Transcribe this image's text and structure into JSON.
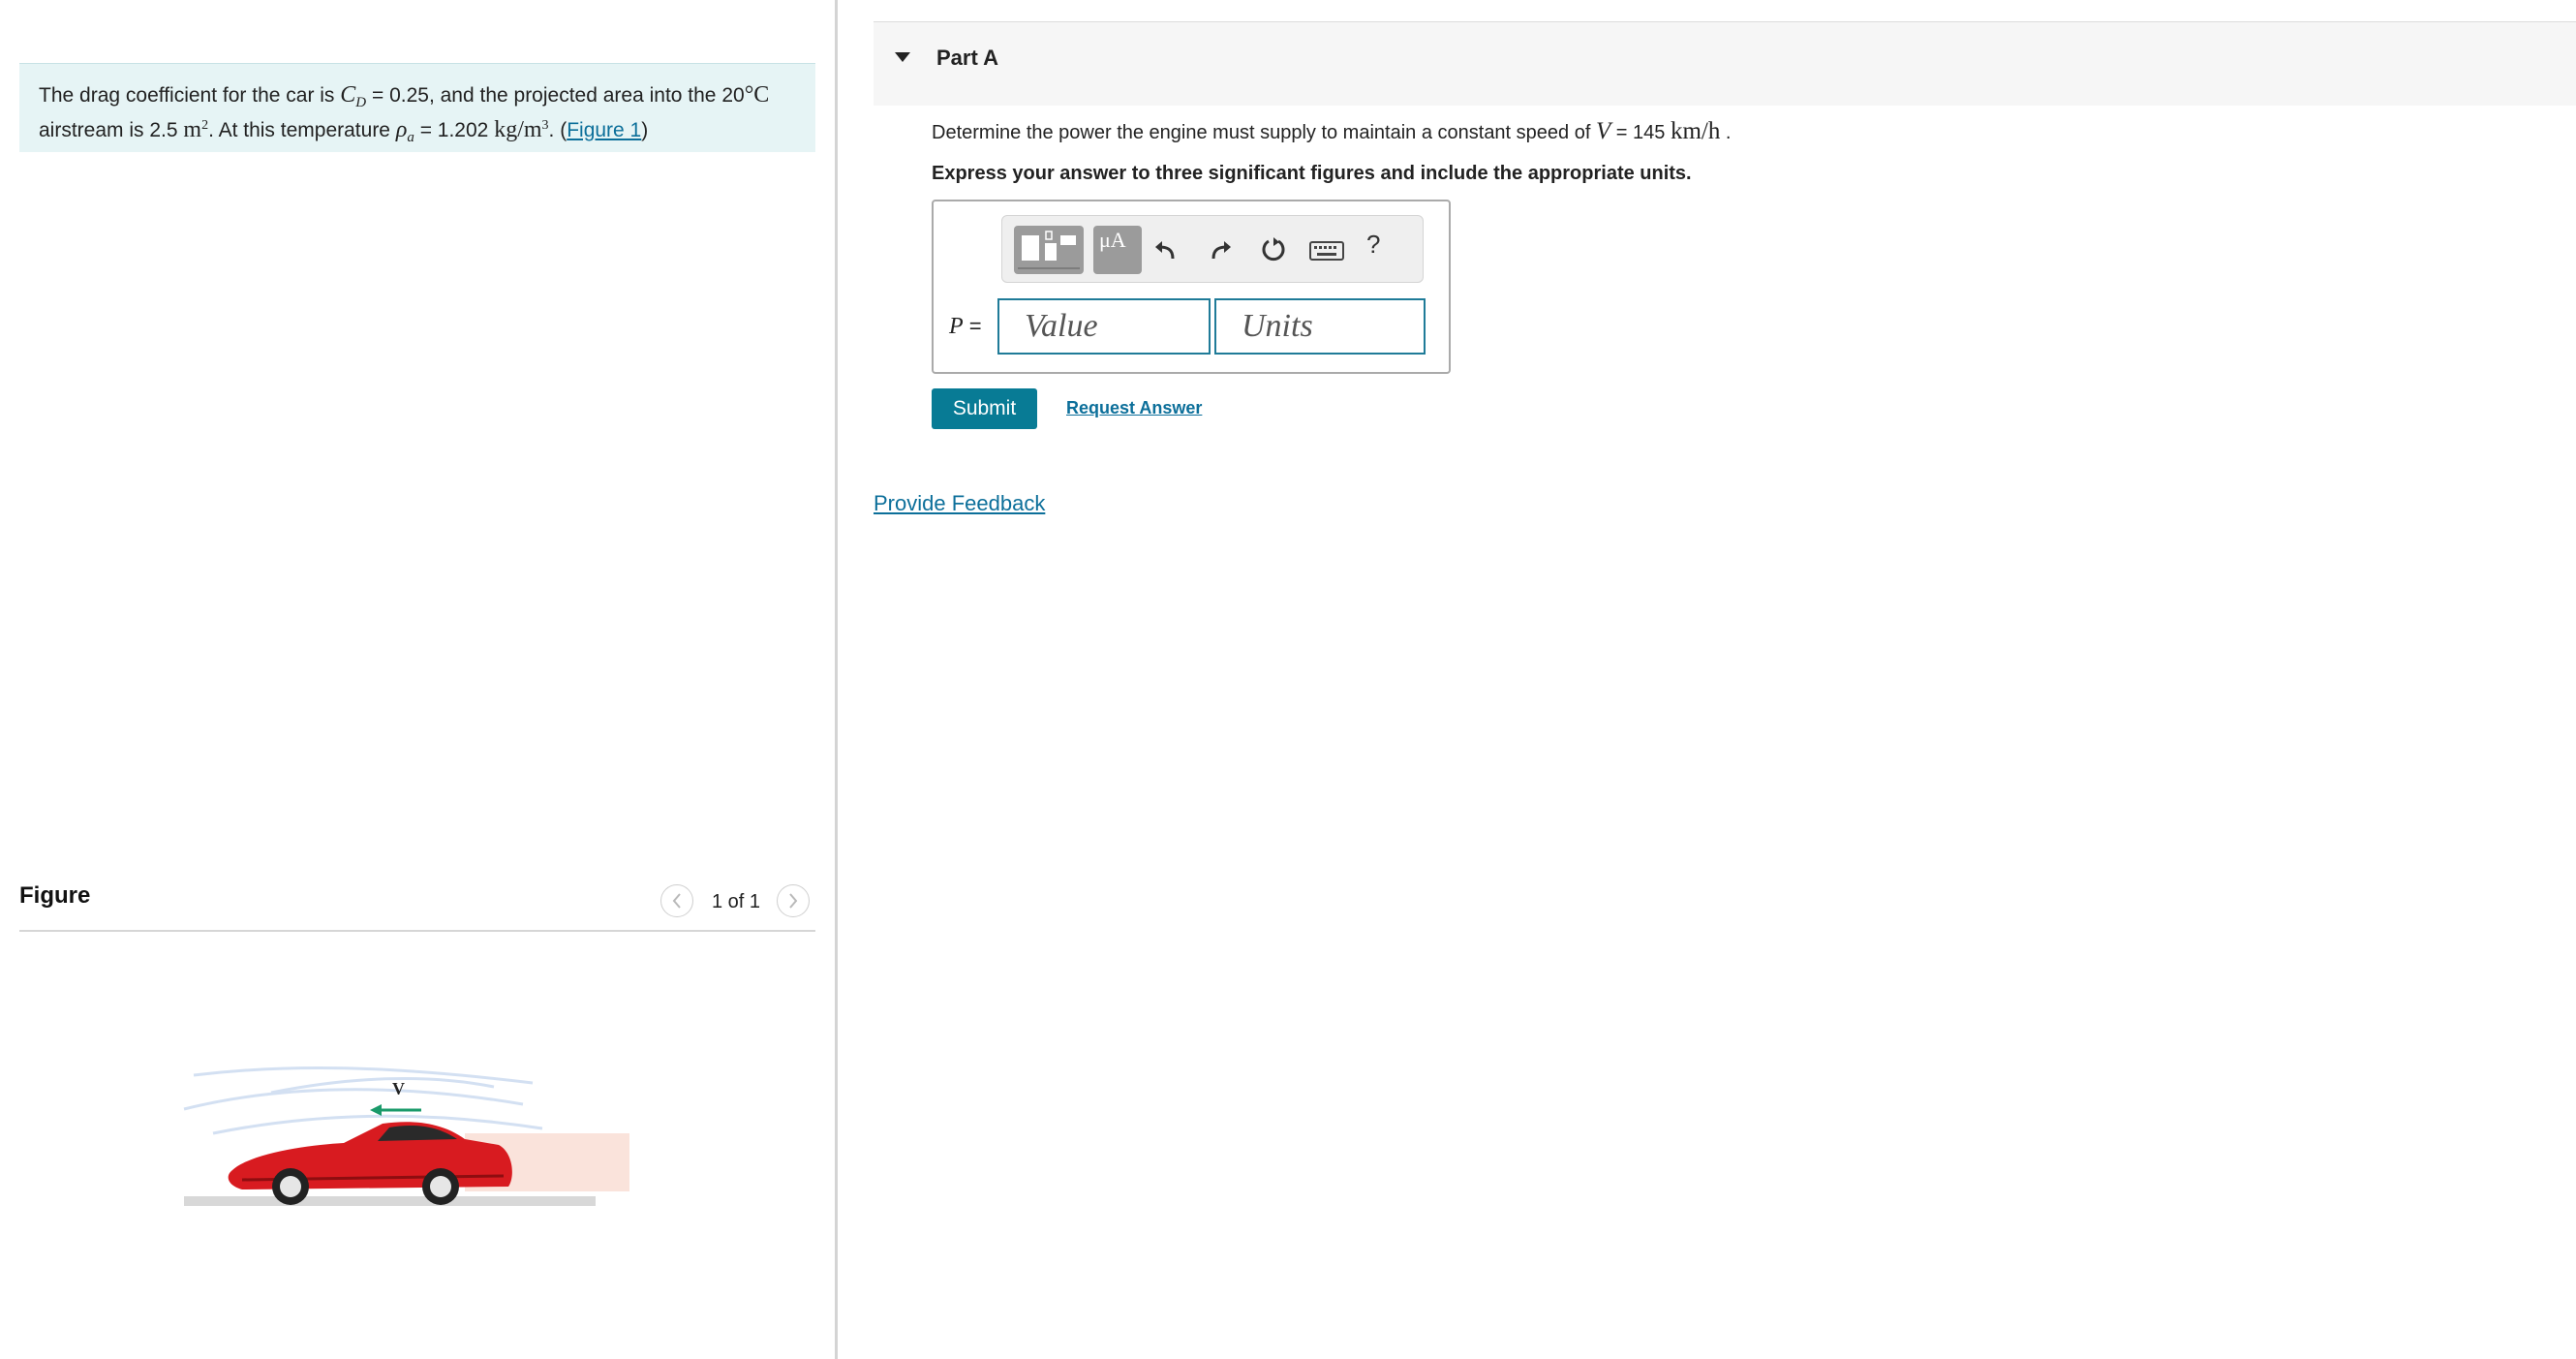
{
  "problem": {
    "text_1": "The drag coefficient for the car is ",
    "cd_symbol": "C",
    "cd_sub": "D",
    "text_2": " = 0.25, and the projected area into the 20",
    "deg_unit": "°C",
    "text_3": "airstream is 2.5 ",
    "area_unit": "m",
    "area_exp": "2",
    "text_4": ". At this temperature ",
    "rho_symbol": "ρ",
    "rho_sub": "a",
    "text_5": " = 1.202 ",
    "density_unit": "kg/m",
    "density_exp": "3",
    "text_6": ". (",
    "figure_link": "Figure 1",
    "text_7": ")"
  },
  "figure": {
    "title": "Figure",
    "pager_count": "1 of 1",
    "velocity_label": "V",
    "icons": {
      "prev": "chevron-left-icon",
      "next": "chevron-right-icon"
    }
  },
  "part": {
    "title": "Part A",
    "toggle_icon": "caret-down-icon",
    "question_prefix": "Determine the power the engine must supply to maintain a constant speed of ",
    "question_var": "V",
    "question_value": " = 145 ",
    "question_unit": "km/h",
    "question_suffix": " .",
    "instruction": "Express your answer to three significant figures and include the appropriate units."
  },
  "toolbar": {
    "symbols_label": "μA",
    "help_label": "?",
    "icons": [
      "templates-icon",
      "symbols-icon",
      "undo-icon",
      "redo-icon",
      "reset-icon",
      "keyboard-icon",
      "help-icon"
    ]
  },
  "answer": {
    "var": "P",
    "equals": " =",
    "value_placeholder": "Value",
    "units_placeholder": "Units"
  },
  "actions": {
    "submit_label": "Submit",
    "request_answer_label": "Request Answer",
    "feedback_label": "Provide Feedback"
  },
  "colors": {
    "accent": "#087b95",
    "problem_bg": "#e6f4f5",
    "input_border": "#1f7b98",
    "link": "#0c6f9a"
  }
}
